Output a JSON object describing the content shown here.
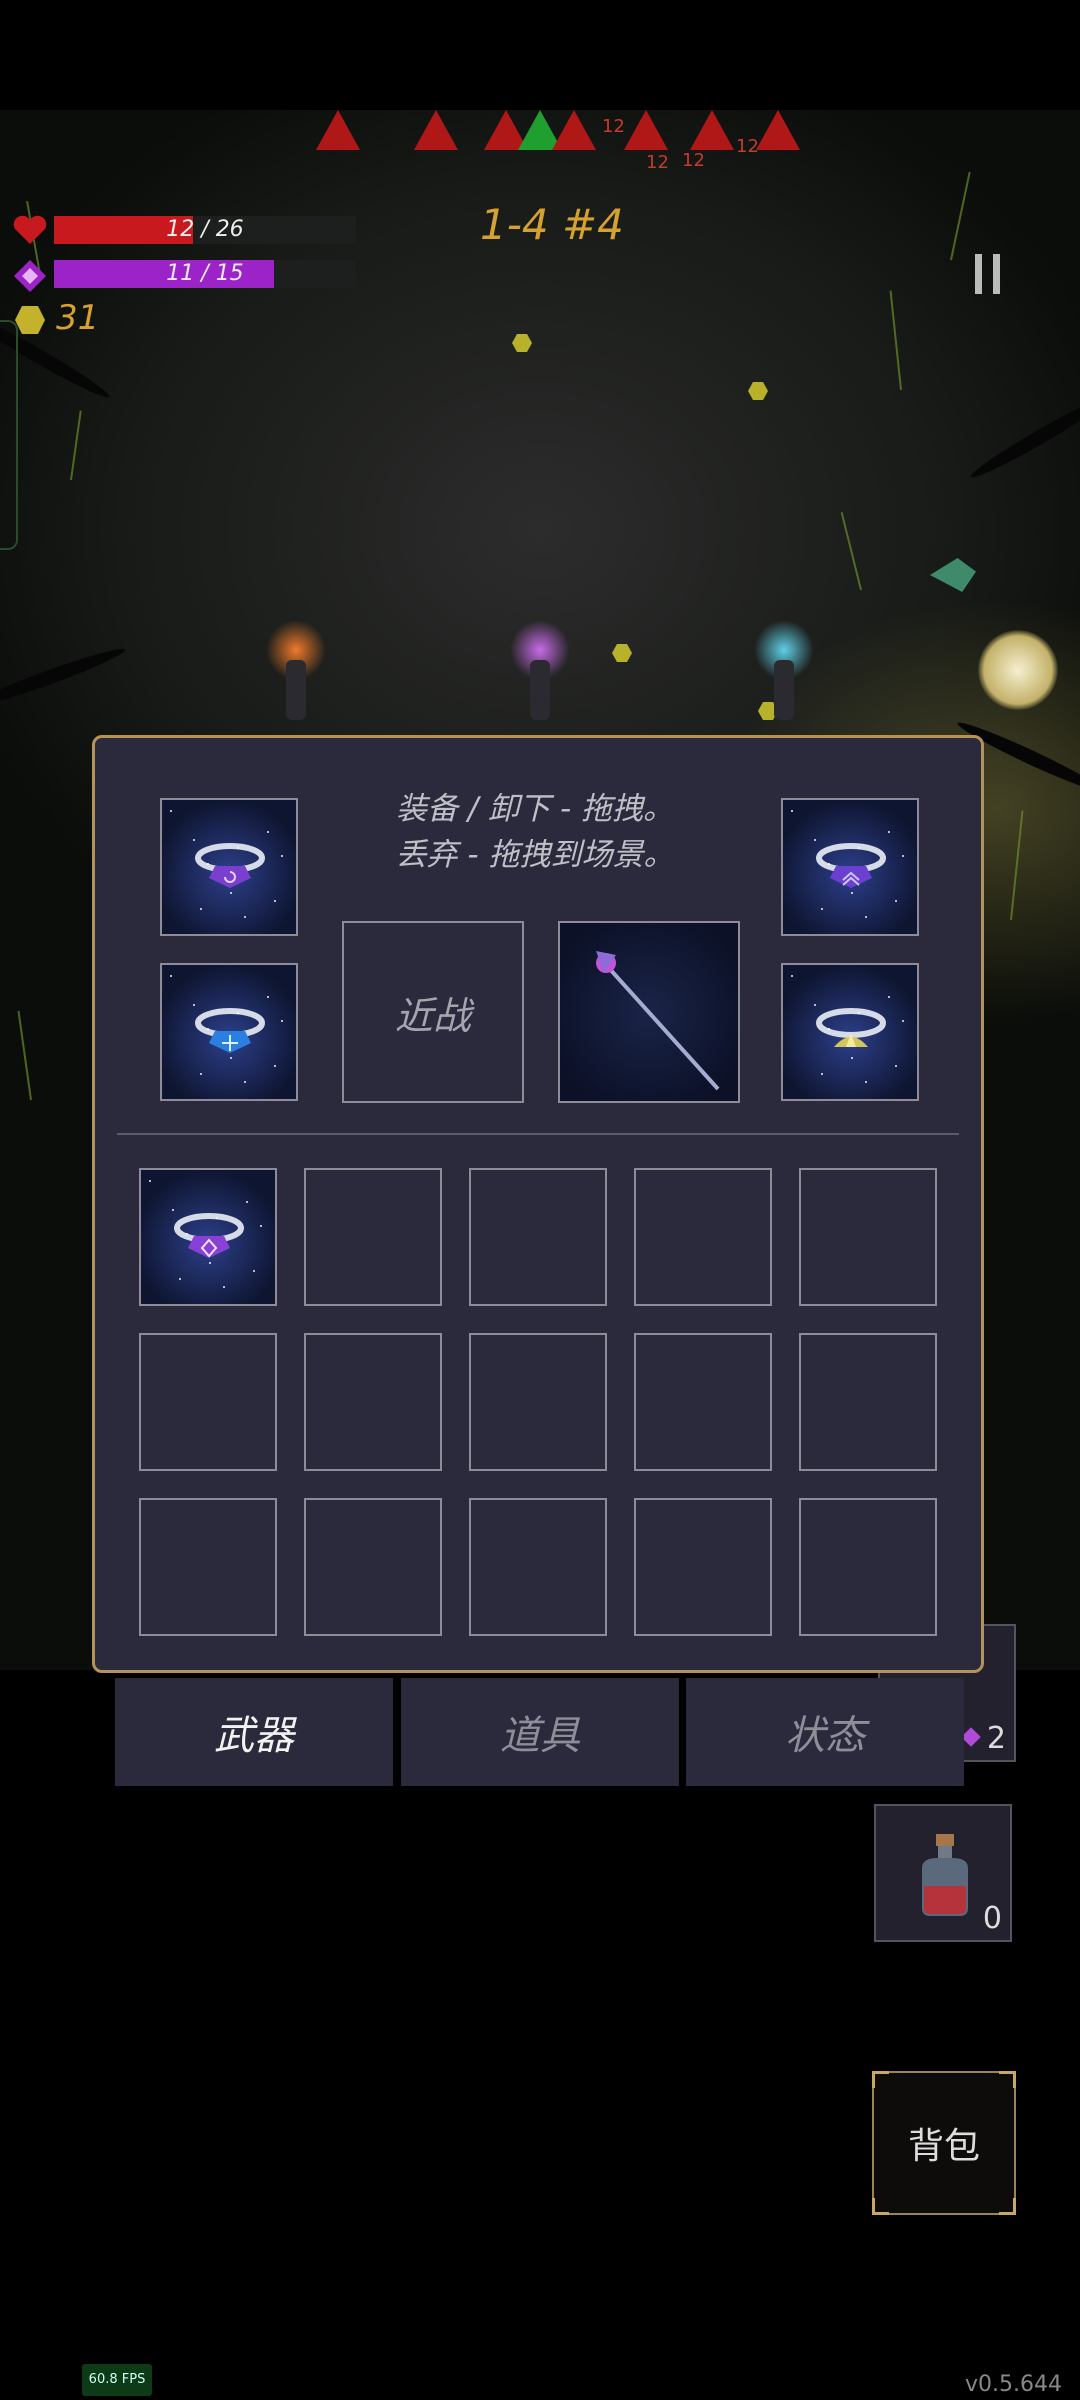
{
  "hud": {
    "health_text": "12 / 26",
    "health_fraction": 0.46,
    "mana_text": "11 / 15",
    "mana_fraction": 0.73,
    "gold": "31",
    "stage": "1-4 #4"
  },
  "damage_numbers": [
    "12",
    "12",
    "12",
    "12"
  ],
  "inventory": {
    "hint_line1": "装备 / 卸下 - 拖拽。",
    "hint_line2": "丢弃 - 拖拽到场景。",
    "melee_label": "近战",
    "equipped_rings": [
      "ring-spiral-icon",
      "ring-chevron-icon",
      "ring-cross-icon",
      "ring-lotus-icon"
    ],
    "weapon": "staff-icon",
    "bag_items": [
      "ring-diamond-icon"
    ]
  },
  "tabs": {
    "weapons": "武器",
    "items": "道具",
    "status": "状态"
  },
  "quickslots": {
    "slot1_count": "2",
    "potion_count": "0"
  },
  "bag_button": "背包",
  "fps": "60.8 FPS",
  "version": "v0.5.644",
  "colors": {
    "health": "#c8191e",
    "mana": "#9b23c7",
    "gold": "#d6a12f",
    "panel_border": "#b59256",
    "panel_bg": "#2b2a3d"
  }
}
